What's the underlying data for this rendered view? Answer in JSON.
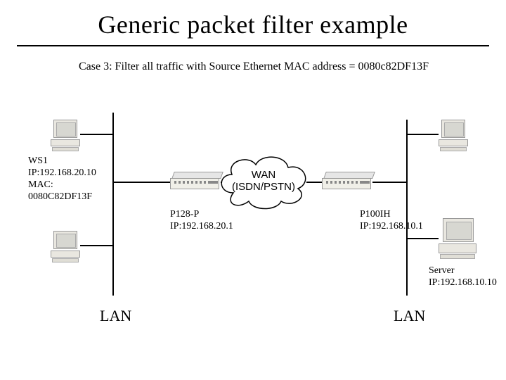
{
  "title": "Generic packet filter example",
  "subtitle": "Case 3: Filter all traffic with Source Ethernet MAC address = 0080c82DF13F",
  "ws1_label": "WS1\nIP:192.168.20.10\nMAC:\n0080C82DF13F",
  "wan_line1": "WAN",
  "wan_line2": "(ISDN/PSTN)",
  "router_left": "P128-P\nIP:192.168.20.1",
  "router_right": "P100IH\nIP:192.168.10.1",
  "server_label": "Server\nIP:192.168.10.10",
  "lan_left": "LAN",
  "lan_right": "LAN"
}
